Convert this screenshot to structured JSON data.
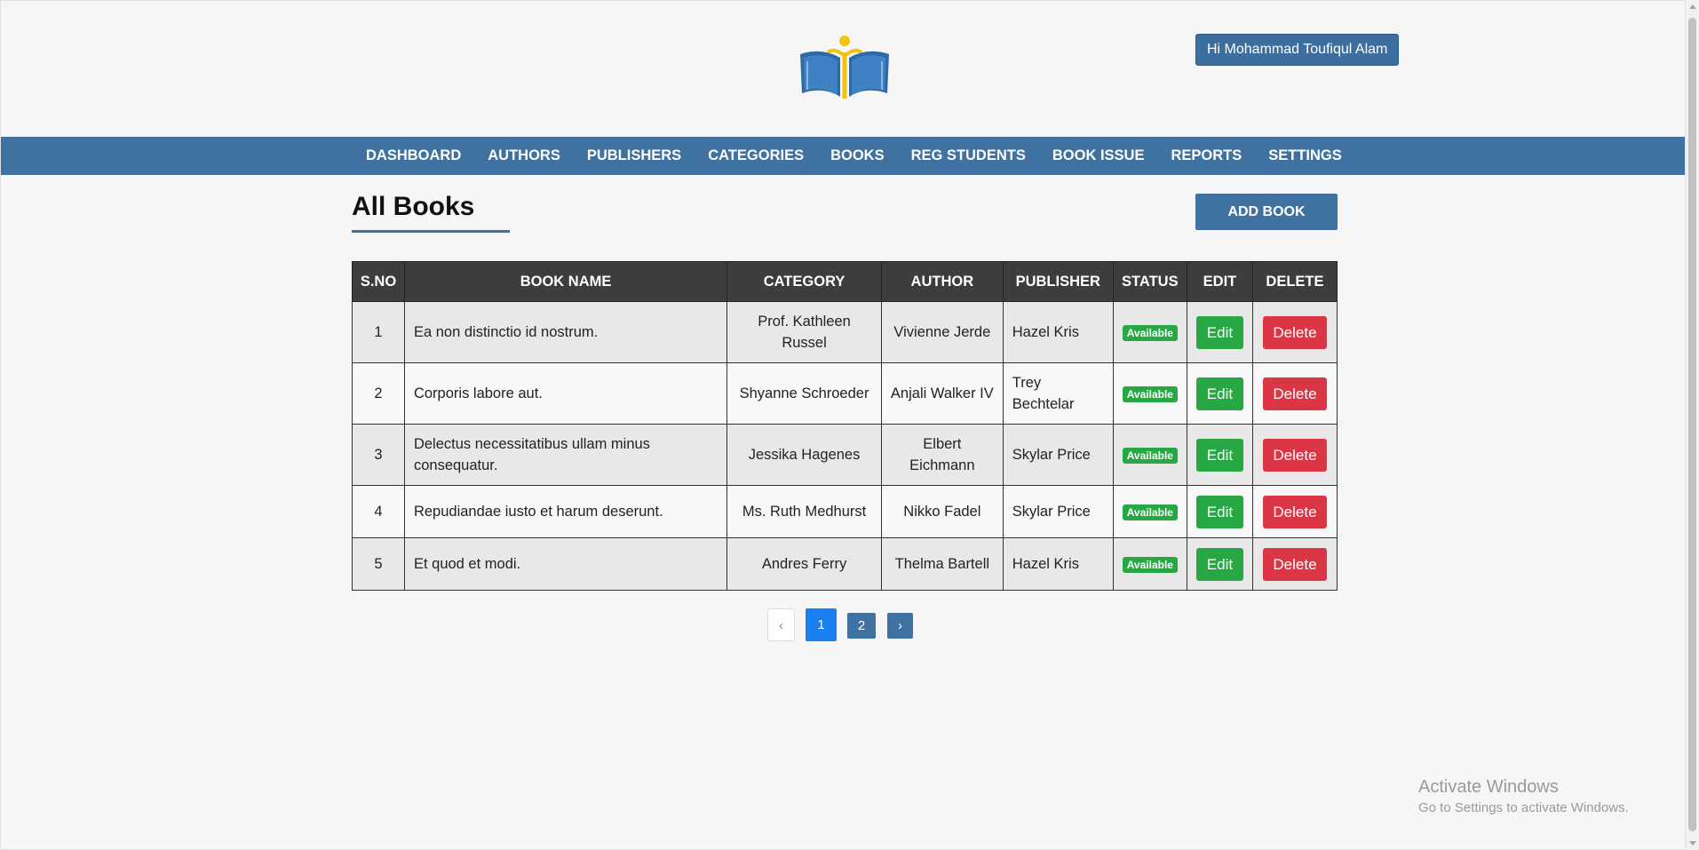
{
  "header": {
    "greeting": "Hi Mohammad Toufiqul Alam",
    "logo": "open-book-reader-logo"
  },
  "nav": {
    "items": [
      "DASHBOARD",
      "AUTHORS",
      "PUBLISHERS",
      "CATEGORIES",
      "BOOKS",
      "REG STUDENTS",
      "BOOK ISSUE",
      "REPORTS",
      "SETTINGS"
    ]
  },
  "main": {
    "title": "All Books",
    "add_button": "ADD BOOK"
  },
  "table": {
    "headers": [
      "S.NO",
      "BOOK NAME",
      "CATEGORY",
      "AUTHOR",
      "PUBLISHER",
      "STATUS",
      "EDIT",
      "DELETE"
    ],
    "rows": [
      {
        "sno": "1",
        "name": "Ea non distinctio id nostrum.",
        "category": "Prof. Kathleen Russel",
        "author": "Vivienne Jerde",
        "publisher": "Hazel Kris",
        "status": "Available",
        "edit": "Edit",
        "delete": "Delete"
      },
      {
        "sno": "2",
        "name": "Corporis labore aut.",
        "category": "Shyanne Schroeder",
        "author": "Anjali Walker IV",
        "publisher": "Trey Bechtelar",
        "status": "Available",
        "edit": "Edit",
        "delete": "Delete"
      },
      {
        "sno": "3",
        "name": "Delectus necessitatibus ullam minus consequatur.",
        "category": "Jessika Hagenes",
        "author": "Elbert Eichmann",
        "publisher": "Skylar Price",
        "status": "Available",
        "edit": "Edit",
        "delete": "Delete"
      },
      {
        "sno": "4",
        "name": "Repudiandae iusto et harum deserunt.",
        "category": "Ms. Ruth Medhurst",
        "author": "Nikko Fadel",
        "publisher": "Skylar Price",
        "status": "Available",
        "edit": "Edit",
        "delete": "Delete"
      },
      {
        "sno": "5",
        "name": "Et quod et modi.",
        "category": "Andres Ferry",
        "author": "Thelma Bartell",
        "publisher": "Hazel Kris",
        "status": "Available",
        "edit": "Edit",
        "delete": "Delete"
      }
    ]
  },
  "pagination": {
    "prev": "‹",
    "pages": [
      "1",
      "2"
    ],
    "current": "1",
    "next": "›"
  },
  "watermark": {
    "title": "Activate Windows",
    "subtitle": "Go to Settings to activate Windows."
  },
  "colors": {
    "primary": "#3f72a0",
    "header_dark": "#3d3d3d",
    "success": "#28a745",
    "danger": "#dc3545",
    "active_page": "#1a7fef"
  }
}
